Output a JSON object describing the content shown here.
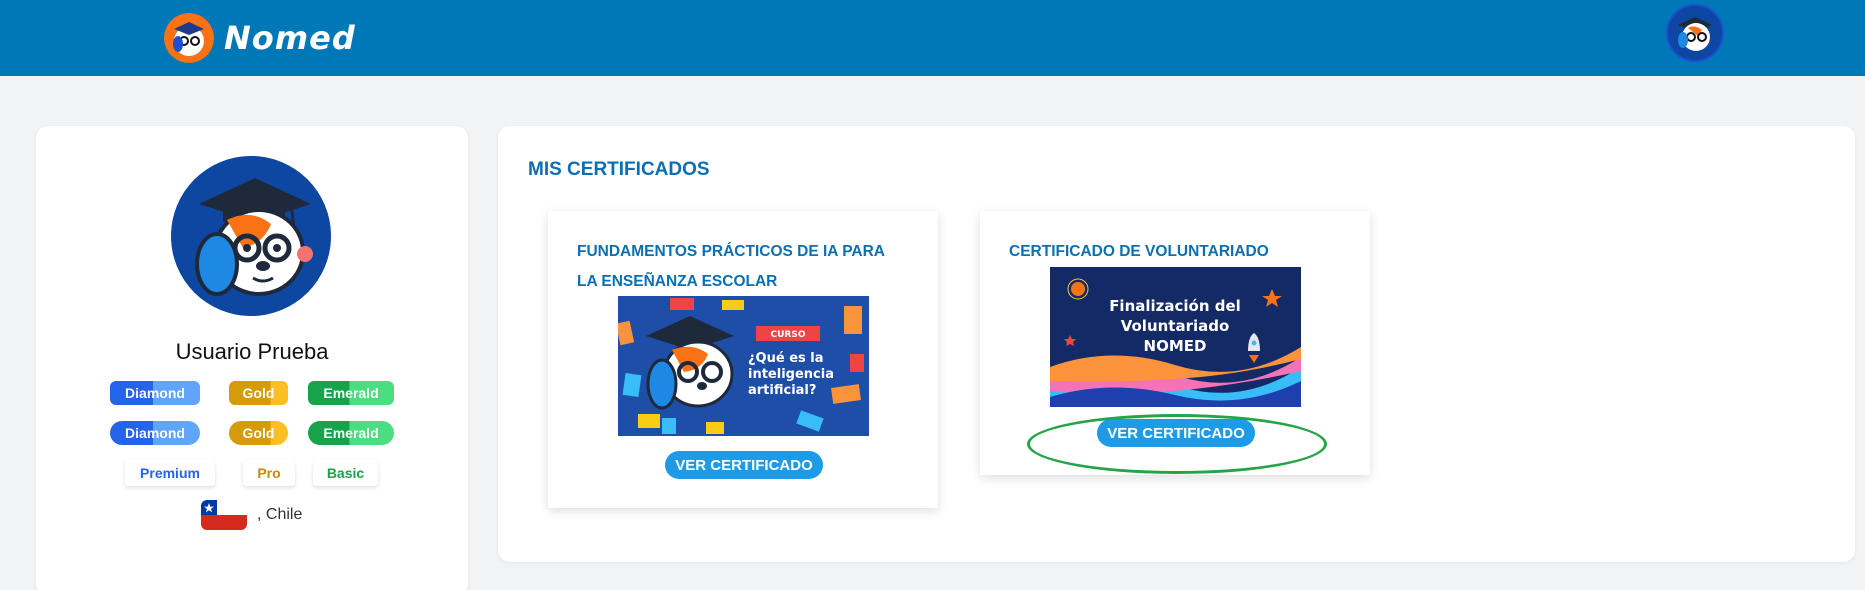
{
  "header": {
    "brand": "Nomed",
    "logo_icon": "dog-mascot-icon",
    "user_avatar_icon": "dog-mascot-icon"
  },
  "profile": {
    "name": "Usuario Prueba",
    "badges_row1": [
      "Diamond",
      "Gold",
      "Emerald"
    ],
    "badges_row2": [
      "Diamond",
      "Gold",
      "Emerald"
    ],
    "tiers": [
      {
        "label": "Premium",
        "color": "#2563eb"
      },
      {
        "label": "Pro",
        "color": "#ca8a04"
      },
      {
        "label": "Basic",
        "color": "#16a34a"
      }
    ],
    "country_text": ", Chile",
    "flag_icon": "chile-flag-icon"
  },
  "certificates": {
    "section_title": "MIS CERTIFICADOS",
    "items": [
      {
        "title_line1": "FUNDAMENTOS PRÁCTICOS DE IA PARA",
        "title_line2": "LA ENSEÑANZA ESCOLAR",
        "image": {
          "tag": "CURSO",
          "line1": "¿Qué es la",
          "line2": "inteligencia",
          "line3": "artificial?"
        },
        "button": "VER CERTIFICADO"
      },
      {
        "title_line1": "CERTIFICADO DE VOLUNTARIADO",
        "image": {
          "line1": "Finalización del",
          "line2": "Voluntariado",
          "line3": "NOMED"
        },
        "button": "VER CERTIFICADO"
      }
    ]
  },
  "colors": {
    "header_bg": "#0077b6",
    "title_blue": "#0b6fb2",
    "button_blue": "#1e9be6",
    "highlight_green": "#22a447"
  }
}
